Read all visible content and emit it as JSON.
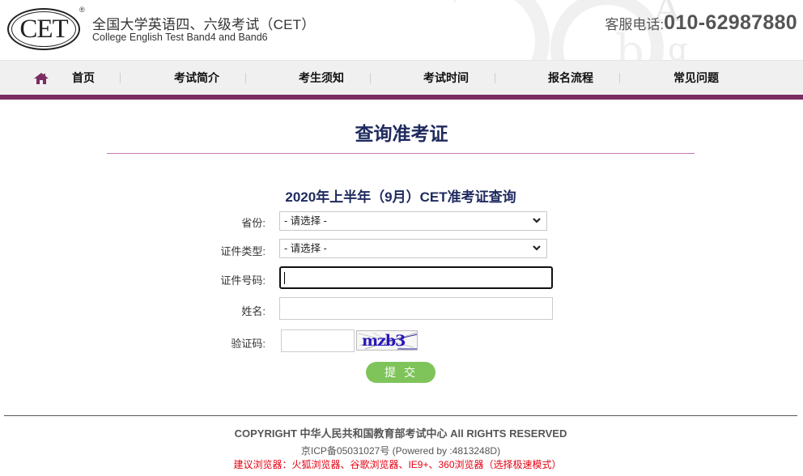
{
  "header": {
    "logo_text": "CET",
    "logo_registered": "®",
    "title_cn": "全国大学英语四、六级考试（CET）",
    "title_en": "College English Test Band4 and Band6",
    "phone_label": "客服电话:",
    "phone_number": "010-62987880"
  },
  "nav": {
    "home_icon": "home-icon",
    "items": [
      {
        "label": "首页"
      },
      {
        "label": "考试简介"
      },
      {
        "label": "考生须知"
      },
      {
        "label": "考试时间"
      },
      {
        "label": "报名流程"
      },
      {
        "label": "常见问题"
      }
    ]
  },
  "main": {
    "page_title": "查询准考证",
    "sub_title": "2020年上半年（9月）CET准考证查询",
    "form": {
      "province_label": "省份:",
      "province_value": "- 请选择 -",
      "id_type_label": "证件类型:",
      "id_type_value": "- 请选择 -",
      "id_number_label": "证件号码:",
      "id_number_value": "",
      "name_label": "姓名:",
      "name_value": "",
      "captcha_label": "验证码:",
      "captcha_value": "",
      "captcha_image_text": "mzb3",
      "submit_label": "提交"
    }
  },
  "footer": {
    "copyright": "COPYRIGHT 中华人民共和国教育部考试中心 All RIGHTS RESERVED",
    "icp": "京ICP备05031027号 (Powered by :4813248D)",
    "browser_tip": "建议浏览器：火狐浏览器、谷歌浏览器、IE9+、360浏览器（选择极速模式）"
  },
  "colors": {
    "brand_purple": "#7b2c62",
    "title_navy": "#1e2a5e",
    "divider_pink": "#c77ab3",
    "submit_green": "#7fc45a",
    "warning_red": "#e60012"
  }
}
